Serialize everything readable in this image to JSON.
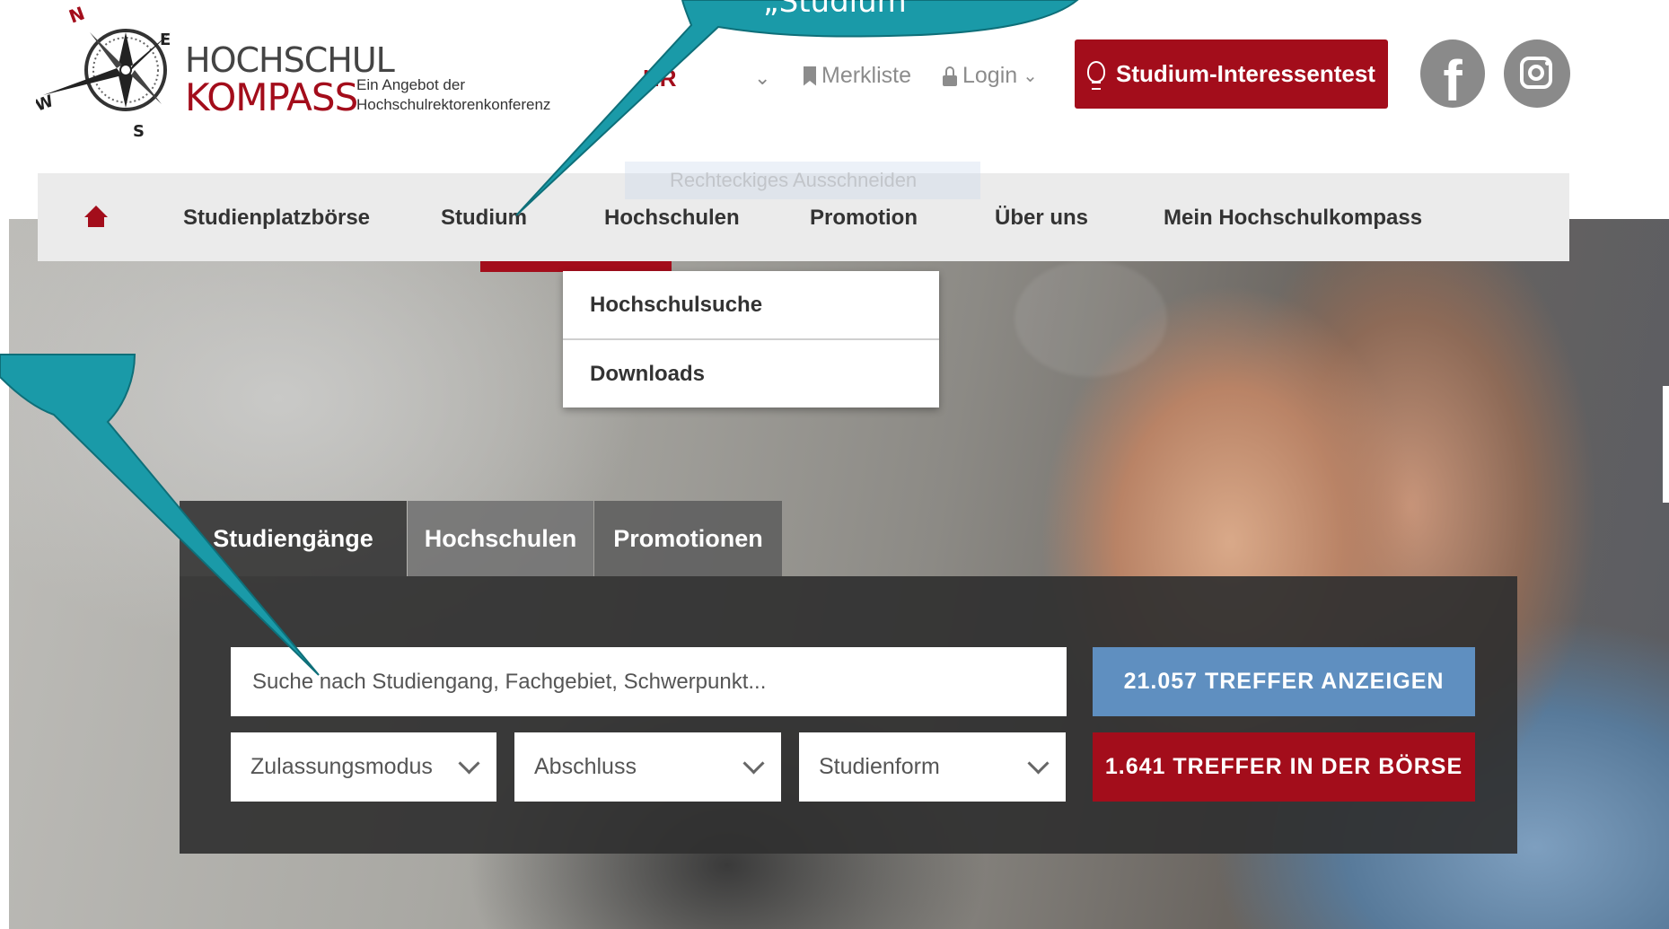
{
  "header": {
    "logo_line1": "HOCHSCHUL",
    "logo_line2": "KOMPASS",
    "compass_n": "N",
    "compass_e": "E",
    "compass_s": "S",
    "compass_w": "W",
    "tagline_1": "Ein Angebot der",
    "tagline_2": "Hochschulrektorenkonferenz",
    "hrk_label": "HR",
    "bookmark_label": "Merkliste",
    "login_label": "Login",
    "cta_label": "Studium-Interessentest",
    "facebook_glyph": "f"
  },
  "nav": {
    "items": [
      {
        "label": "Studienplatzbörse"
      },
      {
        "label": "Studium"
      },
      {
        "label": "Hochschulen"
      },
      {
        "label": "Promotion"
      },
      {
        "label": "Über uns"
      },
      {
        "label": "Mein Hochschulkompass"
      }
    ],
    "ghost_tooltip": "Rechteckiges Ausschneiden"
  },
  "dropdown": {
    "items": [
      {
        "label": "Hochschulsuche"
      },
      {
        "label": "Downloads"
      }
    ]
  },
  "search": {
    "tabs": [
      {
        "label": "Studiengänge"
      },
      {
        "label": "Hochschulen"
      },
      {
        "label": "Promotionen"
      }
    ],
    "placeholder": "Suche nach Studiengang, Fachgebiet, Schwerpunkt...",
    "filters": [
      {
        "label": "Zulassungsmodus"
      },
      {
        "label": "Abschluss"
      },
      {
        "label": "Studienform"
      }
    ],
    "show_results_label": "21.057 TREFFER ANZEIGEN",
    "exchange_results_label": "1.641 TREFFER IN DER BÖRSE"
  },
  "annotation": {
    "bubble_text": "„Studium"
  },
  "colors": {
    "brand_red": "#a30d1b",
    "button_blue": "#5f8fc0",
    "nav_gray": "#ebebeb",
    "callout_teal": "#1a9aa8"
  }
}
